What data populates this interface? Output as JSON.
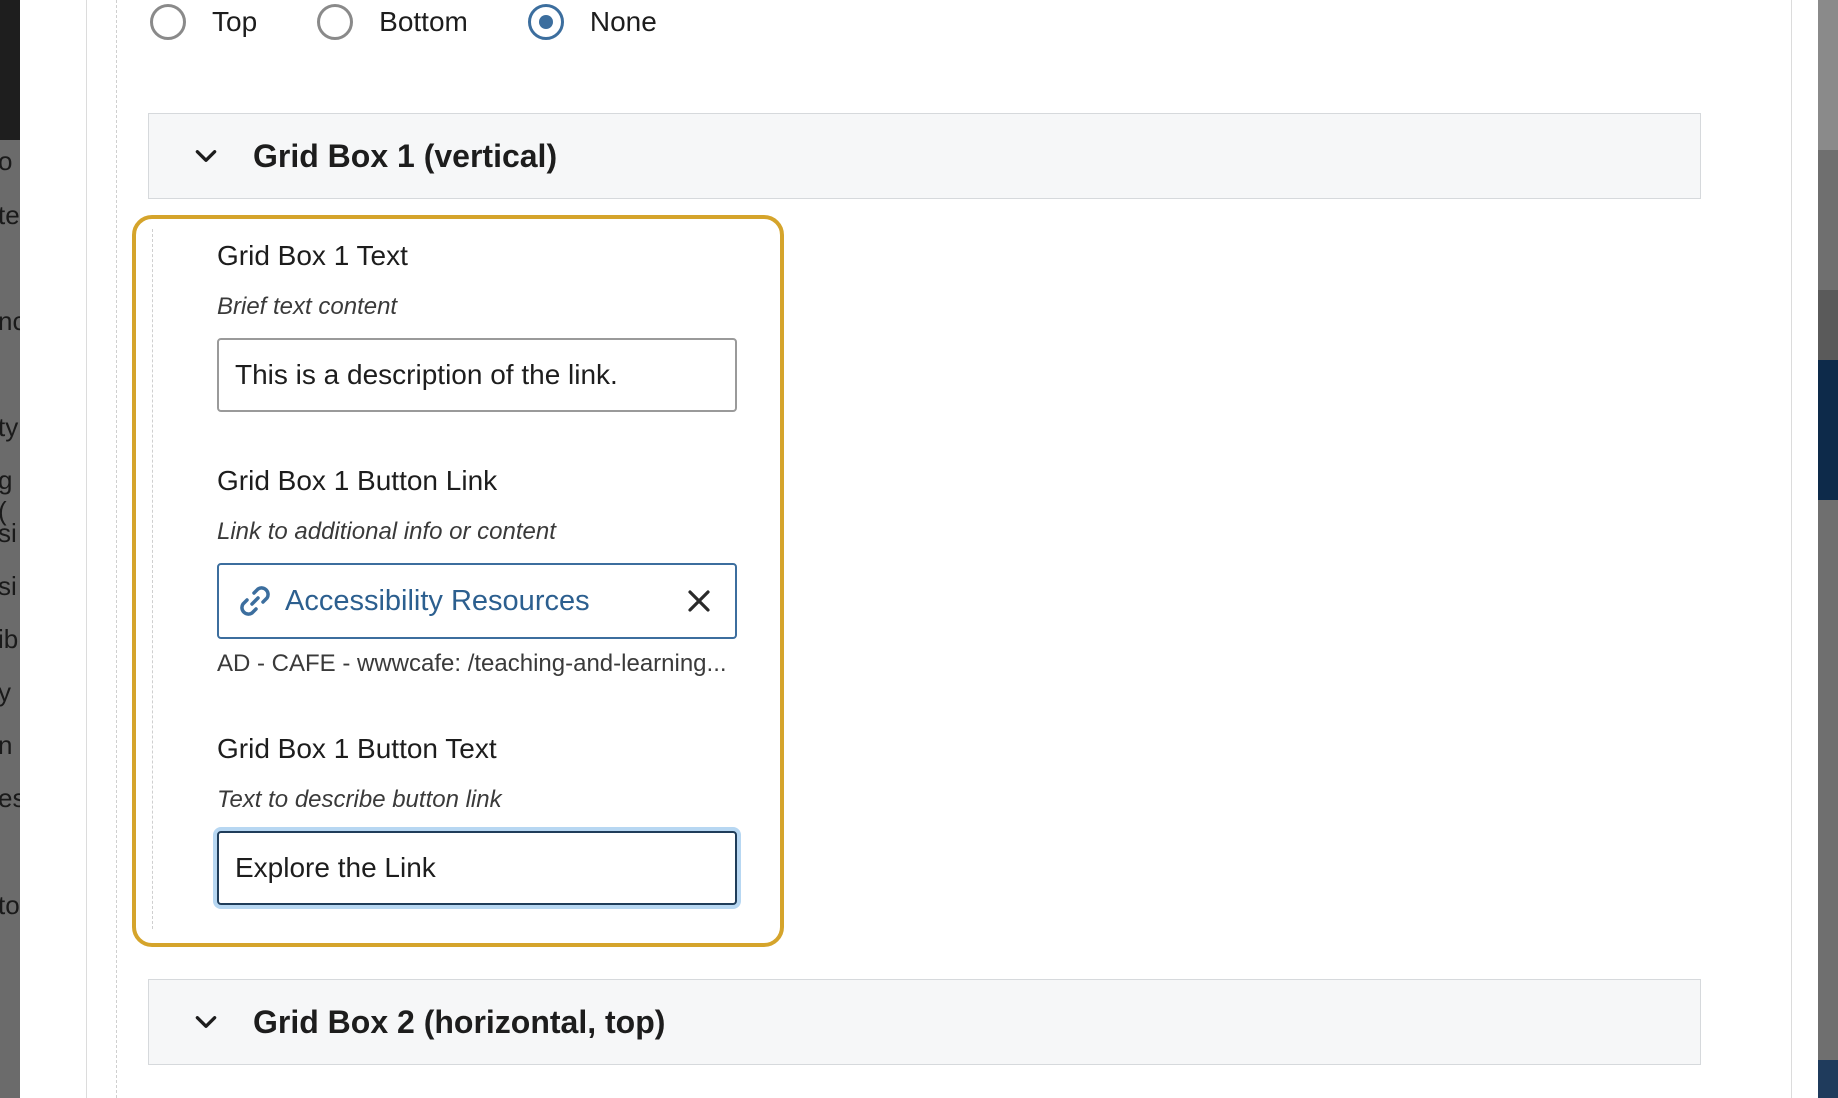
{
  "backdrop_left_fragments": [
    "o",
    "te",
    "nc",
    "ty",
    "g (",
    "si",
    "si",
    "ib",
    "y",
    "n",
    "es",
    "to"
  ],
  "position_radio": {
    "options": [
      {
        "label": "Top",
        "checked": false
      },
      {
        "label": "Bottom",
        "checked": false
      },
      {
        "label": "None",
        "checked": true
      }
    ]
  },
  "accordions": {
    "grid_box_1": {
      "title": "Grid Box 1 (vertical)",
      "expanded": true
    },
    "grid_box_2": {
      "title": "Grid Box 2 (horizontal, top)",
      "expanded": true
    }
  },
  "grid_box_1": {
    "text": {
      "label": "Grid Box 1 Text",
      "description": "Brief text content",
      "value": "This is a description of the link."
    },
    "button_link": {
      "label": "Grid Box 1 Button Link",
      "description": "Link to additional info or content",
      "link_title": "Accessibility Resources",
      "link_path": "AD - CAFE - wwwcafe: /teaching-and-learning..."
    },
    "button_text": {
      "label": "Grid Box 1 Button Text",
      "description": "Text to describe button link",
      "value": "Explore the Link"
    }
  },
  "colors": {
    "focus_outline": "#d5a42b",
    "accent_blue": "#3c6e9e",
    "link_text": "#2c5f8f",
    "accordion_bg": "#f6f7f8"
  },
  "icons": [
    "chevron-down-icon",
    "link-icon",
    "close-icon"
  ]
}
